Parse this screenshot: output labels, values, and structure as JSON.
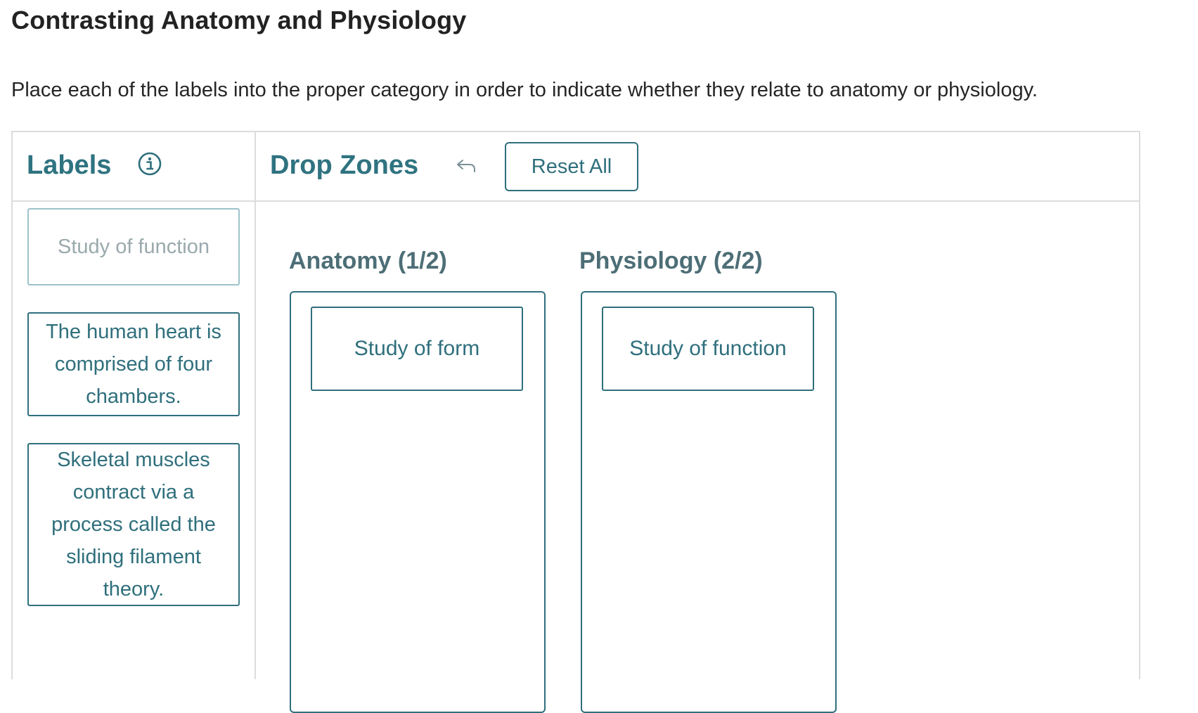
{
  "page": {
    "title": "Contrasting Anatomy and Physiology",
    "instructions": "Place each of the labels into the proper category in order to indicate whether they relate to anatomy or physiology."
  },
  "labels_panel": {
    "heading": "Labels",
    "icon": "info-icon",
    "items": [
      {
        "text": "Study of function",
        "state": "placed"
      },
      {
        "text": "The human heart is comprised of four chambers.",
        "state": "available"
      },
      {
        "text": "Skeletal muscles contract via a process called the sliding filament theory.",
        "state": "available"
      }
    ]
  },
  "drop_panel": {
    "heading": "Drop Zones",
    "undo_icon": "undo-icon",
    "reset_label": "Reset All",
    "zones": [
      {
        "heading": "Anatomy (1/2)",
        "items": [
          "Study of form"
        ]
      },
      {
        "heading": "Physiology (2/2)",
        "items": [
          "Study of function"
        ]
      }
    ]
  },
  "colors": {
    "accent": "#2f6f7c",
    "heading": "#2f7380",
    "zone_heading": "#4d6e76",
    "border": "#dcdcdc",
    "placeholder_border": "#9cc3ca",
    "placeholder_text": "#9aa9ad"
  }
}
